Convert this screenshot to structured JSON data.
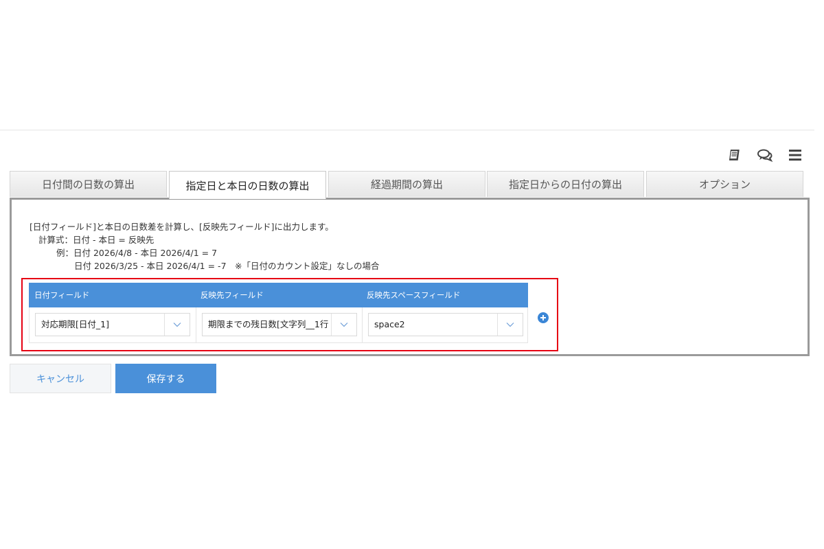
{
  "toolbar": {
    "icons": [
      "book-icon",
      "chat-icon",
      "menu-icon"
    ]
  },
  "tabs": [
    {
      "label": "日付間の日数の算出",
      "active": false
    },
    {
      "label": "指定日と本日の日数の算出",
      "active": true
    },
    {
      "label": "経過期間の算出",
      "active": false
    },
    {
      "label": "指定日からの日付の算出",
      "active": false
    },
    {
      "label": "オプション",
      "active": false
    }
  ],
  "description": {
    "line1": "[日付フィールド]と本日の日数差を計算し、[反映先フィールド]に出力します。",
    "line2": "計算式：日付 - 本日 = 反映先",
    "line3": "例：日付 2026/4/8 - 本日 2026/4/1 = 7",
    "line4": "日付 2026/3/25 - 本日 2026/4/1 = -7　※「日付のカウント設定」なしの場合"
  },
  "table": {
    "headers": [
      "日付フィールド",
      "反映先フィールド",
      "反映先スペースフィールド"
    ],
    "row": {
      "date_field": "対応期限[日付_1]",
      "target_field": "期限までの残日数[文字列__1行",
      "space_field": "space2"
    }
  },
  "buttons": {
    "cancel": "キャンセル",
    "save": "保存する"
  },
  "colors": {
    "accent": "#4a90d9",
    "highlight_border": "#e60012",
    "add_button": "#3b86d6"
  }
}
